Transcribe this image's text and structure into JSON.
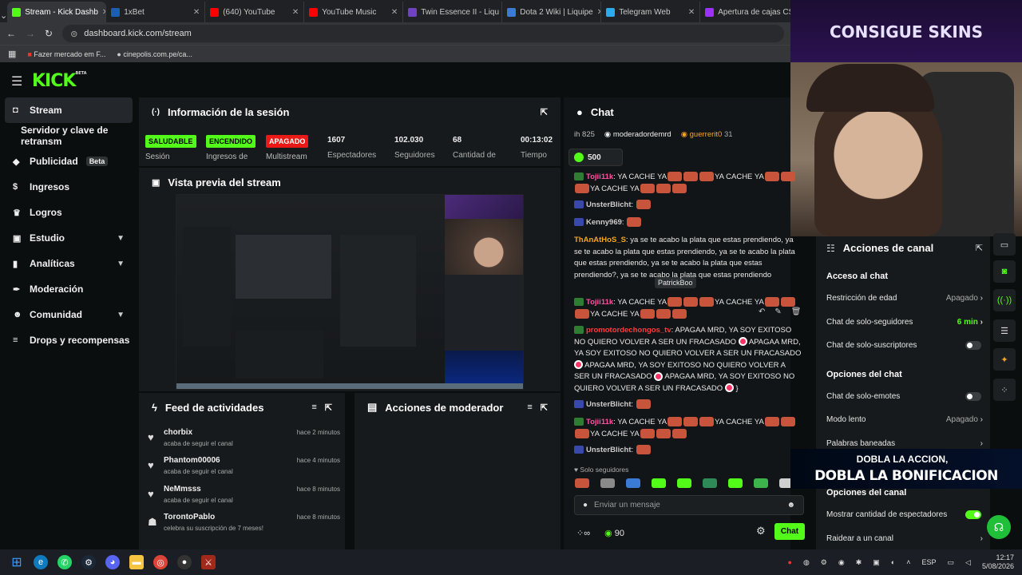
{
  "browser": {
    "tabs": [
      {
        "label": "Stream - Kick Dashb",
        "color": "#53fc18",
        "active": true
      },
      {
        "label": "1xBet",
        "color": "#1a5fb4"
      },
      {
        "label": "(640) YouTube",
        "color": "#ff0000"
      },
      {
        "label": "YouTube Music",
        "color": "#ff0000"
      },
      {
        "label": "Twin Essence II - Liqu",
        "color": "#6f42c1"
      },
      {
        "label": "Dota 2 Wiki | Liquipe",
        "color": "#3a7bd5"
      },
      {
        "label": "Telegram Web",
        "color": "#2aabee"
      },
      {
        "label": "Apertura de cajas CS",
        "color": "#9b30ff"
      }
    ],
    "url": "dashboard.kick.com/stream",
    "bookmarks": [
      "Fazer mercado em F...",
      "cinepolis.com.pe/ca..."
    ]
  },
  "brand": {
    "logo": "KICK",
    "beta": "BETA"
  },
  "sidebar": {
    "items": [
      {
        "label": "Stream",
        "active": true
      },
      {
        "label": "Servidor y clave de retransm"
      },
      {
        "label": "Publicidad",
        "badge": "Beta"
      },
      {
        "label": "Ingresos"
      },
      {
        "label": "Logros"
      },
      {
        "label": "Estudio",
        "chevron": true
      },
      {
        "label": "Analíticas",
        "chevron": true
      },
      {
        "label": "Moderación"
      },
      {
        "label": "Comunidad",
        "chevron": true
      },
      {
        "label": "Drops y recompensas"
      }
    ]
  },
  "session": {
    "title": "Información de la sesión",
    "badges": [
      {
        "label": "SALUDABLE",
        "sub": "Sesión",
        "color": "#53fc18"
      },
      {
        "label": "ENCENDIDO",
        "sub": "Ingresos de",
        "color": "#53fc18"
      },
      {
        "label": "APAGADO",
        "sub": "Multistream",
        "color": "#e91916"
      }
    ],
    "stats": [
      {
        "value": "1607",
        "label": "Espectadores"
      },
      {
        "value": "102.030",
        "label": "Seguidores"
      },
      {
        "value": "68",
        "label": "Cantidad de"
      },
      {
        "value": "00:13:02",
        "label": "Tiempo"
      }
    ]
  },
  "preview": {
    "title": "Vista previa del stream"
  },
  "feed": {
    "title": "Feed de actividades",
    "items": [
      {
        "name": "chorbix",
        "desc": "acaba de seguir el canal",
        "time": "hace 2 minutos"
      },
      {
        "name": "Phantom00006",
        "desc": "acaba de seguir el canal",
        "time": "hace 4 minutos"
      },
      {
        "name": "NeMmsss",
        "desc": "acaba de seguir el canal",
        "time": "hace 8 minutos"
      },
      {
        "name": "TorontoPablo",
        "desc": "celebra su suscripción de 7 meses!",
        "time": "hace 8 minutos"
      }
    ]
  },
  "mod_actions": {
    "title": "Acciones de moderador"
  },
  "chat": {
    "title": "Chat",
    "top_users": [
      {
        "name": "ih 825"
      },
      {
        "name": "moderadordemrd"
      },
      {
        "name": "guerrerit0",
        "count": "31"
      }
    ],
    "gift": "500",
    "messages": [
      {
        "user": "Tojii11k",
        "color": "#ff4fa3",
        "text": "YA CACHE YA",
        "text2": "YA CACHE YA",
        "text3": "YA CACHE YA"
      },
      {
        "user": "UnsterBlicht",
        "color": "#cccccc",
        "text": ""
      },
      {
        "user": "Kenny969",
        "color": "#cccccc",
        "text": ""
      },
      {
        "user": "ThAnAtHoS_S",
        "color": "#f5a623",
        "text": "ya se te acabo la plata que estas prendiendo, ya se te acabo la plata que estas prendiendo, ya se te acabo la plata que estas prendiendo, ya se te acabo la plata que estas prendiendo?, ya se te acabo la plata que estas prendiendo"
      },
      {
        "user": "Tojii11k",
        "color": "#ff4fa3",
        "text": "YA CACHE YA",
        "text2": "YA CACHE YA",
        "text3": "YA CACHE YA"
      },
      {
        "user": "promotordechongos_tv",
        "color": "#ff3b3b",
        "text": "APAGAA MRD, YA SOY EXITOSO NO QUIERO VOLVER A SER UN FRACASADO",
        "text2": "APAGAA MRD, YA SOY EXITOSO NO QUIERO VOLVER A SER UN FRACASADO",
        "text3": "APAGAA MRD, YA SOY EXITOSO NO QUIERO VOLVER A SER UN FRACASADO",
        "text4": "APAGAA MRD, YA SOY EXITOSO NO QUIERO VOLVER A SER UN FRACASADO",
        "tail": "}"
      },
      {
        "user": "UnsterBlicht",
        "color": "#cccccc",
        "text": ""
      },
      {
        "user": "Tojii11k",
        "color": "#ff4fa3",
        "text": "YA CACHE YA",
        "text2": "YA CACHE YA",
        "text3": "YA CACHE YA"
      },
      {
        "user": "UnsterBlicht",
        "color": "#cccccc",
        "text": ""
      }
    ],
    "hover_name": "PatrickBoo",
    "followers_only": "Solo seguidores",
    "input_placeholder": "Enviar un mensaje",
    "points": "90",
    "send_label": "Chat"
  },
  "channel_actions": {
    "title": "Acciones de canal",
    "sections": [
      {
        "title": "Acceso al chat",
        "rows": [
          {
            "label": "Restricción de edad",
            "value": "Apagado",
            "type": "select"
          },
          {
            "label": "Chat de solo-seguidores",
            "value": "6 min",
            "type": "select",
            "accent": true
          },
          {
            "label": "Chat de solo-suscriptores",
            "type": "toggle",
            "on": false
          }
        ]
      },
      {
        "title": "Opciones del chat",
        "rows": [
          {
            "label": "Chat de solo-emotes",
            "type": "toggle",
            "on": false
          },
          {
            "label": "Modo lento",
            "value": "Apagado",
            "type": "select"
          },
          {
            "label": "Palabras baneadas",
            "type": "link"
          }
        ]
      },
      {
        "title": "Opciones del canal",
        "rows": [
          {
            "label": "Mostrar cantidad de espectadores",
            "type": "toggle",
            "on": true
          },
          {
            "label": "Raidear a un canal",
            "type": "link"
          }
        ]
      }
    ]
  },
  "overlay": {
    "banner": "CONSIGUE SKINS",
    "promo_line1": "DOBLA LA ACCION,",
    "promo_line2": "DOBLA LA BONIFICACION"
  },
  "taskbar": {
    "lang": "ESP",
    "time": "12:17",
    "date": "5/08/2026"
  }
}
